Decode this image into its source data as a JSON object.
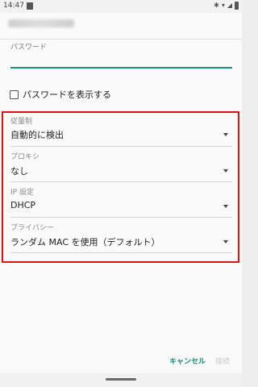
{
  "status_bar": {
    "time": "14:47",
    "icons": [
      "notification-icon",
      "bluetooth-icon",
      "wifi-icon",
      "signal-icon",
      "battery-icon"
    ]
  },
  "dialog": {
    "password": {
      "label": "パスワード",
      "value": "",
      "accent": "#1e8f86"
    },
    "show_password": {
      "label": "パスワードを表示する",
      "checked": false
    },
    "fields": [
      {
        "label": "従量制",
        "value": "自動的に検出"
      },
      {
        "label": "プロキシ",
        "value": "なし"
      },
      {
        "label": "IP 設定",
        "value": "DHCP"
      },
      {
        "label": "プライバシー",
        "value": "ランダム MAC を使用（デフォルト）"
      }
    ],
    "highlight_color": "#e21212"
  },
  "buttons": {
    "cancel": "キャンセル",
    "connect": "接続"
  }
}
